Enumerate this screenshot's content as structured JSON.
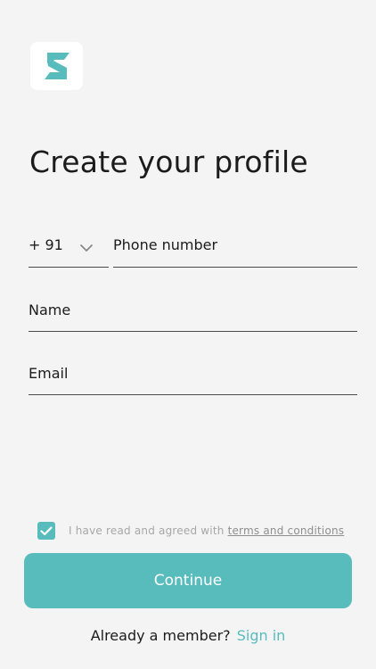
{
  "app": {
    "logo_icon": "app-logo-s-arrow",
    "accent_color": "#58bcbc"
  },
  "header": {
    "title": "Create your profile"
  },
  "form": {
    "country_code": "+ 91",
    "country_icon": "chevron-down-icon",
    "phone_placeholder": "Phone number",
    "name_placeholder": "Name",
    "email_placeholder": "Email"
  },
  "agreement": {
    "checked": true,
    "text": "I have read and agreed with",
    "link": "terms and conditions"
  },
  "actions": {
    "continue_label": "Continue"
  },
  "footer": {
    "prompt": "Already a member?",
    "signin_label": "Sign in"
  }
}
